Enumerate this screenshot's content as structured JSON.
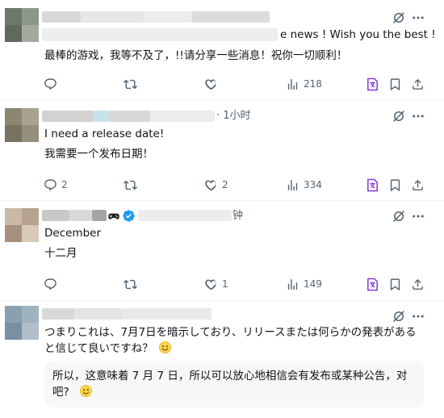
{
  "posts": [
    {
      "time": "",
      "text_en": "e news ! Wish you the best !",
      "text_zh": "最棒的游戏，我等不及了，!!请分享一些消息！祝你一切顺利！",
      "replies": "",
      "reposts": "",
      "likes": "",
      "views": "218"
    },
    {
      "time": "· 1小时",
      "text_en": "I need a release date!",
      "text_zh": "我需要一个发布日期！",
      "replies": "2",
      "reposts": "",
      "likes": "2",
      "views": "334"
    },
    {
      "time": "钟",
      "verified": true,
      "text_en": "December",
      "text_zh": "十二月",
      "replies": "",
      "reposts": "",
      "likes": "1",
      "views": "149"
    },
    {
      "text_ja_1": "つまりこれは、7月7日を暗示しており、リリースまたは何らかの発表がある",
      "text_ja_2": "と信じて良いですね？",
      "translation_1": "所以，这意味着 7 月 7 日，所以可以放心地相信会有发布或某种公告，对",
      "translation_2": "吧?"
    }
  ],
  "colors": {
    "accent": "#1d9bf0",
    "muted": "#536471",
    "translate_icon": "#7b2bd6"
  },
  "icons": [
    "grok-icon",
    "more-icon",
    "reply-icon",
    "repost-icon",
    "like-icon",
    "views-icon",
    "translate-icon",
    "bookmark-icon",
    "share-icon",
    "verified-badge-icon",
    "smile-emoji"
  ]
}
